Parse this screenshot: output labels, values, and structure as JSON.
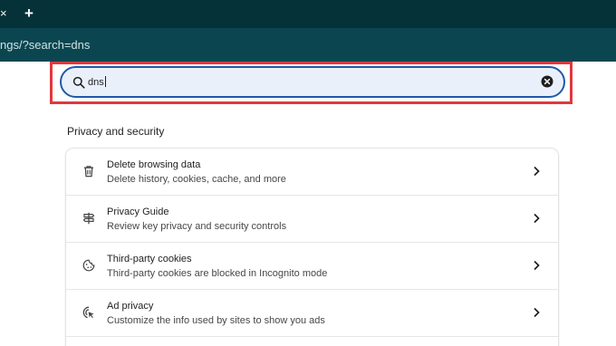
{
  "tab": {
    "close_glyph": "×",
    "new_tab_glyph": "+"
  },
  "address_bar": {
    "url": "ngs/?search=dns"
  },
  "search": {
    "value": "dns"
  },
  "section": {
    "title": "Privacy and security"
  },
  "rows": [
    {
      "title": "Delete browsing data",
      "subtitle": "Delete history, cookies, cache, and more",
      "icon": "trash-icon"
    },
    {
      "title": "Privacy Guide",
      "subtitle": "Review key privacy and security controls",
      "icon": "signpost-icon"
    },
    {
      "title": "Third-party cookies",
      "subtitle": "Third-party cookies are blocked in Incognito mode",
      "icon": "cookie-icon"
    },
    {
      "title": "Ad privacy",
      "subtitle": "Customize the info used by sites to show you ads",
      "icon": "ad-privacy-icon"
    }
  ],
  "colors": {
    "tabbar": "#053238",
    "toolbar": "#0b4650",
    "highlight": "#e0383e",
    "search_border": "#1e5aa8",
    "search_fill": "#eaf0fa"
  }
}
